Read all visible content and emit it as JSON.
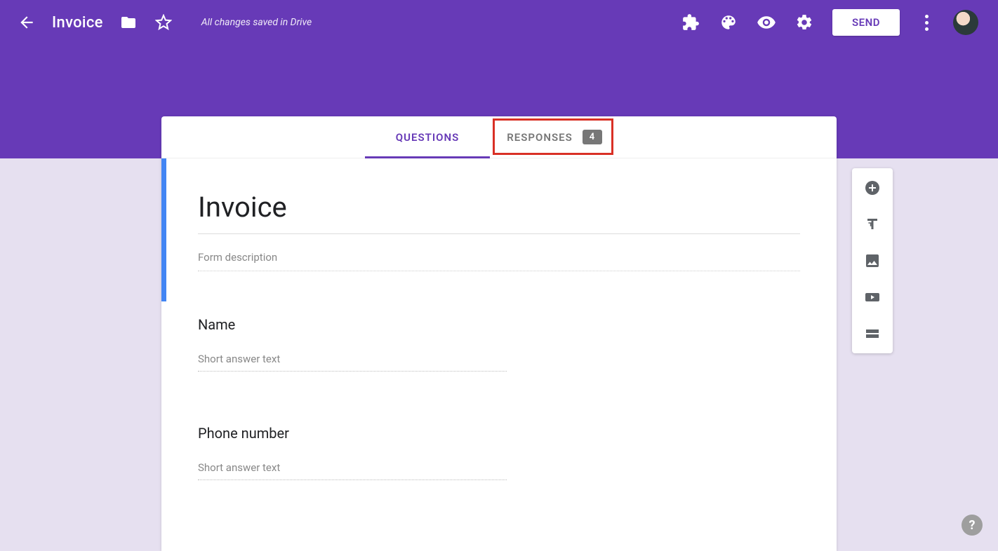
{
  "header": {
    "title": "Invoice",
    "save_status": "All changes saved in Drive",
    "send_label": "SEND"
  },
  "tabs": {
    "questions": "QUESTIONS",
    "responses": "RESPONSES",
    "response_count": "4"
  },
  "form": {
    "title": "Invoice",
    "description_placeholder": "Form description"
  },
  "questions": [
    {
      "title": "Name",
      "placeholder": "Short answer text"
    },
    {
      "title": "Phone number",
      "placeholder": "Short answer text"
    }
  ],
  "help_label": "?"
}
